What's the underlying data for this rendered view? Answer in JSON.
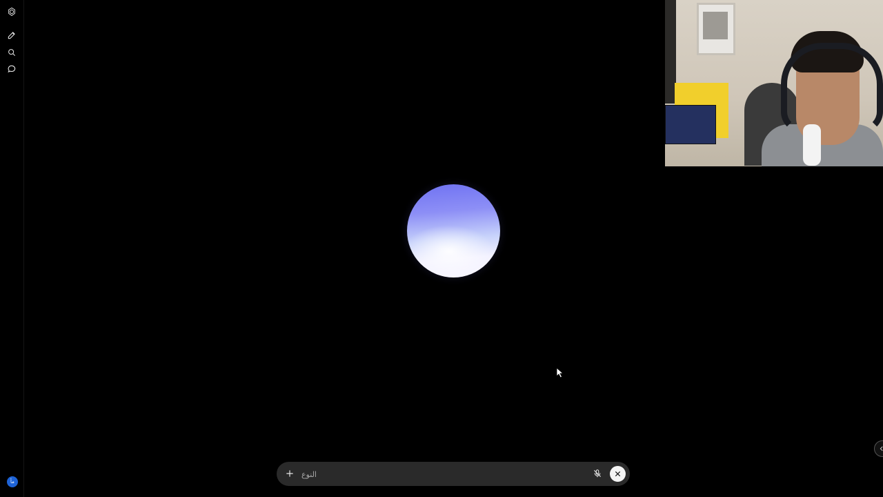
{
  "sidebar": {
    "items": [
      {
        "name": "logo",
        "icon": "openai-logo-icon"
      },
      {
        "name": "new-chat",
        "icon": "edit-icon"
      },
      {
        "name": "search",
        "icon": "search-icon"
      },
      {
        "name": "chats",
        "icon": "chat-bubble-icon"
      }
    ],
    "avatar_initials": "مأ"
  },
  "voice": {
    "orb_colors": {
      "top": "#6f72f2",
      "bottom": "#f8f7ff"
    }
  },
  "composer": {
    "placeholder": "النوع",
    "add_icon": "plus-icon",
    "mute_icon": "mic-off-icon",
    "close_icon": "close-icon"
  },
  "colors": {
    "background": "#000000",
    "composer_bg": "#2a2a2a",
    "avatar": "#1e63d6"
  }
}
